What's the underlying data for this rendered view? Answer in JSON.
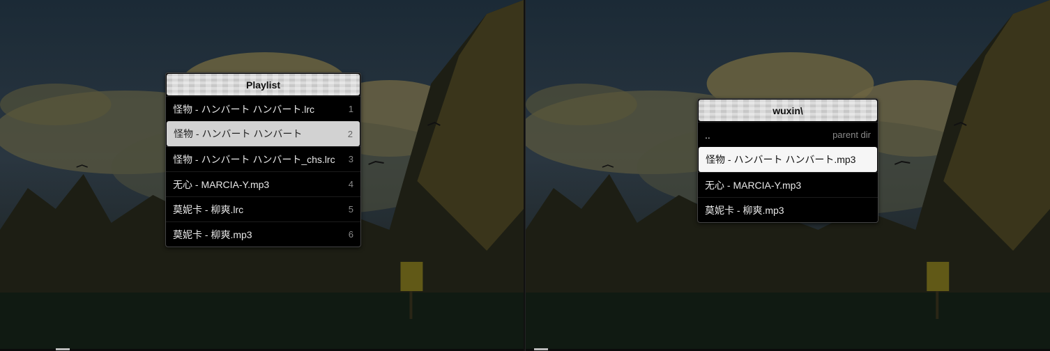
{
  "left_panel": {
    "title": "Playlist",
    "items": [
      {
        "label": "怪物 - ハンバート ハンバート.lrc",
        "num": "1"
      },
      {
        "label": "怪物 - ハンバート ハンバート",
        "num": "2"
      },
      {
        "label": "怪物 - ハンバート ハンバート_chs.lrc",
        "num": "3"
      },
      {
        "label": "无心 - MARCIA-Y.mp3",
        "num": "4"
      },
      {
        "label": "莫妮卡 - 柳爽.lrc",
        "num": "5"
      },
      {
        "label": "莫妮卡 - 柳爽.mp3",
        "num": "6"
      }
    ]
  },
  "right_panel": {
    "title": "wuxin\\",
    "items": [
      {
        "label": "..",
        "hint": "parent dir"
      },
      {
        "label": "怪物 - ハンバート ハンバート.mp3"
      },
      {
        "label": "无心 - MARCIA-Y.mp3"
      },
      {
        "label": "莫妮卡 - 柳爽.mp3"
      }
    ]
  },
  "colors": {
    "sky": "#1e2c3a",
    "cloud": "#7d7040",
    "forest": "#1a1a12",
    "selected_grey": "#d2d2d2",
    "selected_white": "#f6f6f6"
  }
}
